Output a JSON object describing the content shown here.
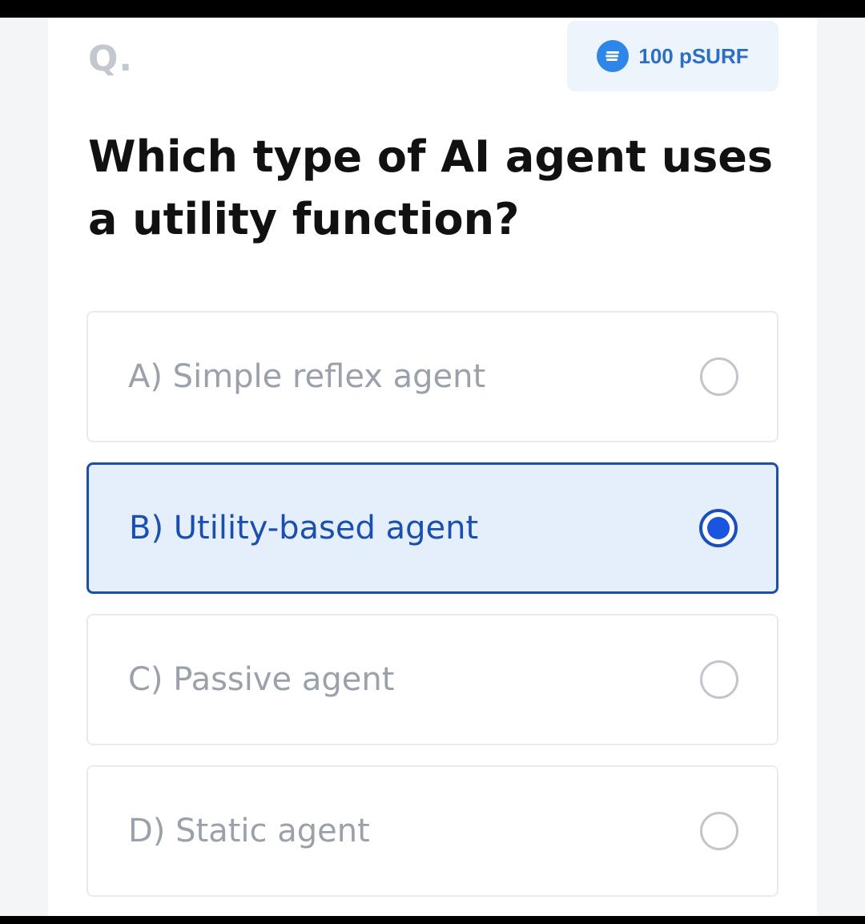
{
  "header": {
    "q_mark": "Q.",
    "reward_label": "100 pSURF",
    "reward_icon": "coin-icon"
  },
  "question": {
    "text": "Which type of AI agent uses a utility function?"
  },
  "options": [
    {
      "label": "A) Simple reflex agent",
      "selected": false
    },
    {
      "label": "B) Utility-based agent",
      "selected": true
    },
    {
      "label": "C) Passive agent",
      "selected": false
    },
    {
      "label": "D) Static agent",
      "selected": false
    }
  ],
  "colors": {
    "accent": "#1a55e0",
    "selected_bg": "#e5effc",
    "reward_bg": "#eef4fb",
    "reward_text": "#2a6fc4",
    "muted_text": "#9aa1ab"
  }
}
